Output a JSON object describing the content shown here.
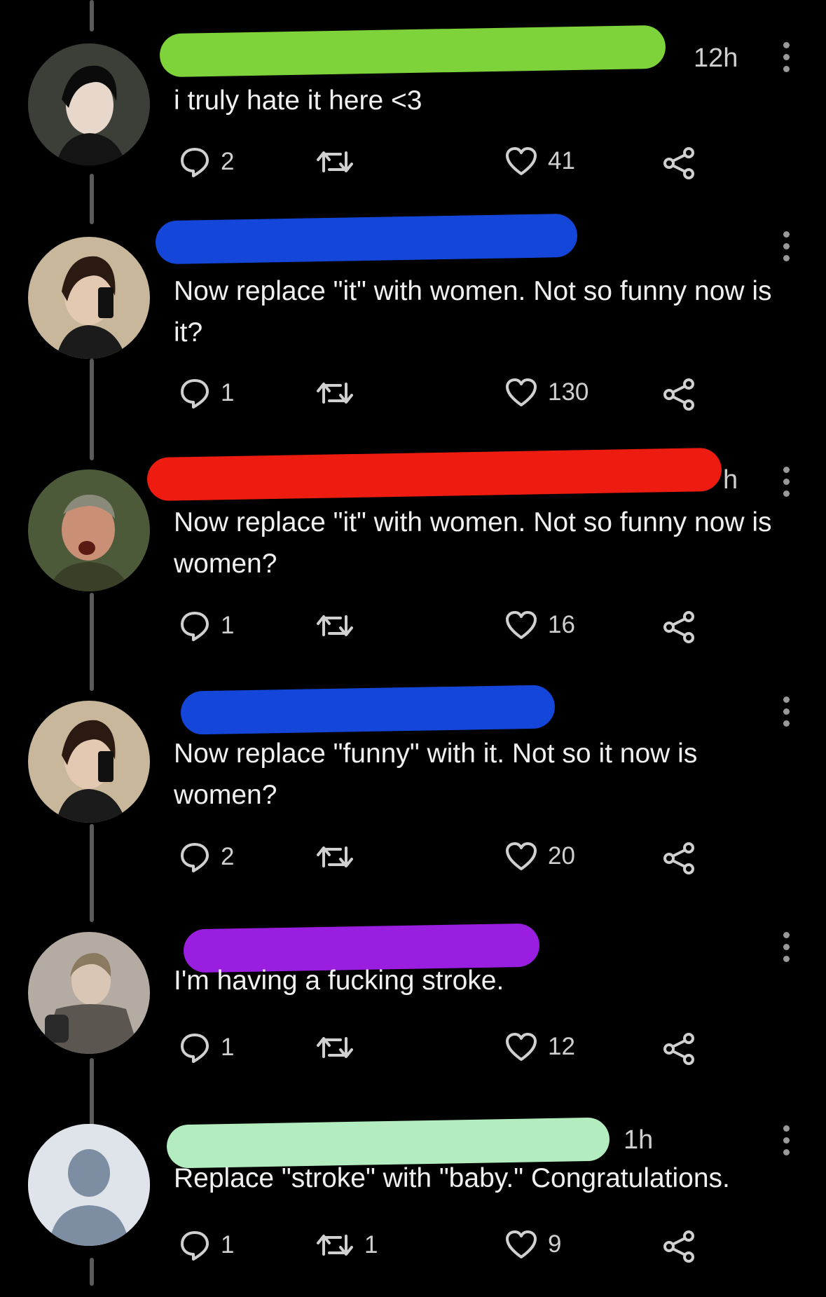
{
  "posts": [
    {
      "redaction_color": "#7ed23a",
      "timestamp": "12h",
      "text": "i truly hate it here <3",
      "replies": "2",
      "reposts": "",
      "likes": "41"
    },
    {
      "redaction_color": "#1446d9",
      "timestamp": "",
      "text": "Now replace \"it\" with women. Not so funny now is it?",
      "replies": "1",
      "reposts": "",
      "likes": "130"
    },
    {
      "redaction_color": "#ee1c10",
      "timestamp": "h",
      "text": "Now replace \"it\" with women. Not so funny now is women?",
      "replies": "1",
      "reposts": "",
      "likes": "16"
    },
    {
      "redaction_color": "#1446d9",
      "timestamp": "",
      "text": "Now replace \"funny\" with it. Not so it now is women?",
      "replies": "2",
      "reposts": "",
      "likes": "20"
    },
    {
      "redaction_color": "#9a1ee0",
      "timestamp": "",
      "text": "I'm having a fucking stroke.",
      "replies": "1",
      "reposts": "",
      "likes": "12"
    },
    {
      "redaction_color": "#b3ecbf",
      "timestamp": "1h",
      "text": "Replace \"stroke\" with \"baby.\" Congratulations.",
      "replies": "1",
      "reposts": "1",
      "likes": "9"
    }
  ],
  "icons": {
    "reply": "reply-icon",
    "repost": "repost-icon",
    "like": "heart-icon",
    "share": "share-icon",
    "more": "more-options-icon"
  }
}
